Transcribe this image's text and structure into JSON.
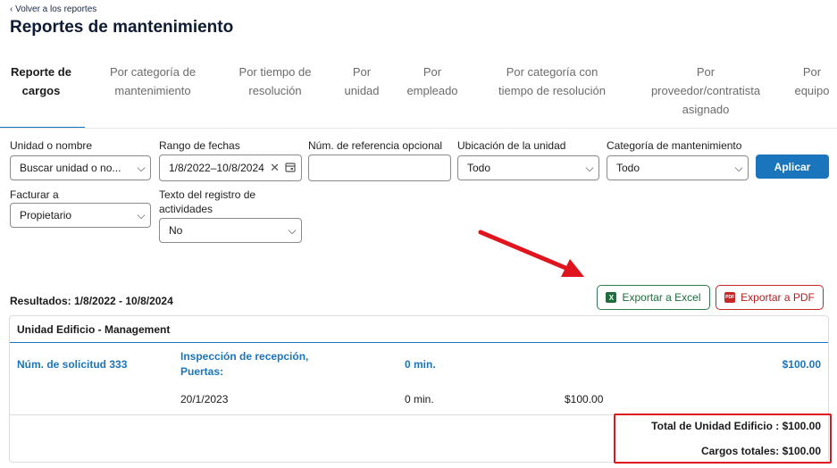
{
  "header": {
    "back_label": "‹ Volver a los reportes",
    "title": "Reportes de mantenimiento"
  },
  "tabs": [
    {
      "label": "Reporte de cargos",
      "active": true
    },
    {
      "label": "Por categoría de mantenimiento",
      "active": false
    },
    {
      "label": "Por tiempo de resolución",
      "active": false
    },
    {
      "label": "Por unidad",
      "active": false
    },
    {
      "label": "Por empleado",
      "active": false
    },
    {
      "label": "Por categoría con tiempo de resolución",
      "active": false
    },
    {
      "label": "Por proveedor/contratista asignado",
      "active": false
    },
    {
      "label": "Por equipo",
      "active": false
    }
  ],
  "filters": {
    "unit": {
      "label": "Unidad o nombre",
      "value": "Buscar unidad o no..."
    },
    "date_range": {
      "label": "Rango de fechas",
      "start": "1/8/2022",
      "sep": "–",
      "end": "10/8/2024"
    },
    "reference": {
      "label": "Núm. de referencia opcional",
      "value": ""
    },
    "location": {
      "label": "Ubicación de la unidad",
      "value": "Todo"
    },
    "category": {
      "label": "Categoría de mantenimiento",
      "value": "Todo"
    },
    "bill_to": {
      "label": "Facturar a",
      "value": "Propietario"
    },
    "activity_log": {
      "label": "Texto del registro de actividades",
      "value": "No"
    },
    "apply_label": "Aplicar"
  },
  "results": {
    "label": "Resultados: 1/8/2022 - 10/8/2024",
    "export_excel": "Exportar a Excel",
    "export_pdf": "Exportar a PDF",
    "excel_icon_text": "X",
    "pdf_icon_text": "PDF"
  },
  "card": {
    "heading": "Unidad Edificio - Management",
    "request": {
      "label": "Núm. de solicitud 333",
      "description": "Inspección de recepción, Puertas:",
      "time": "0 min.",
      "amount": "$100.00"
    },
    "entry": {
      "date": "20/1/2023",
      "time": "0 min.",
      "amount": "$100.00"
    },
    "unit_total": "Total de Unidad Edificio : $100.00",
    "grand_total": "Cargos totales: $100.00"
  },
  "colors": {
    "accent": "#1b75bc",
    "excel": "#1f6d3e",
    "pdf": "#c62828",
    "annotation": "#e0141c"
  }
}
